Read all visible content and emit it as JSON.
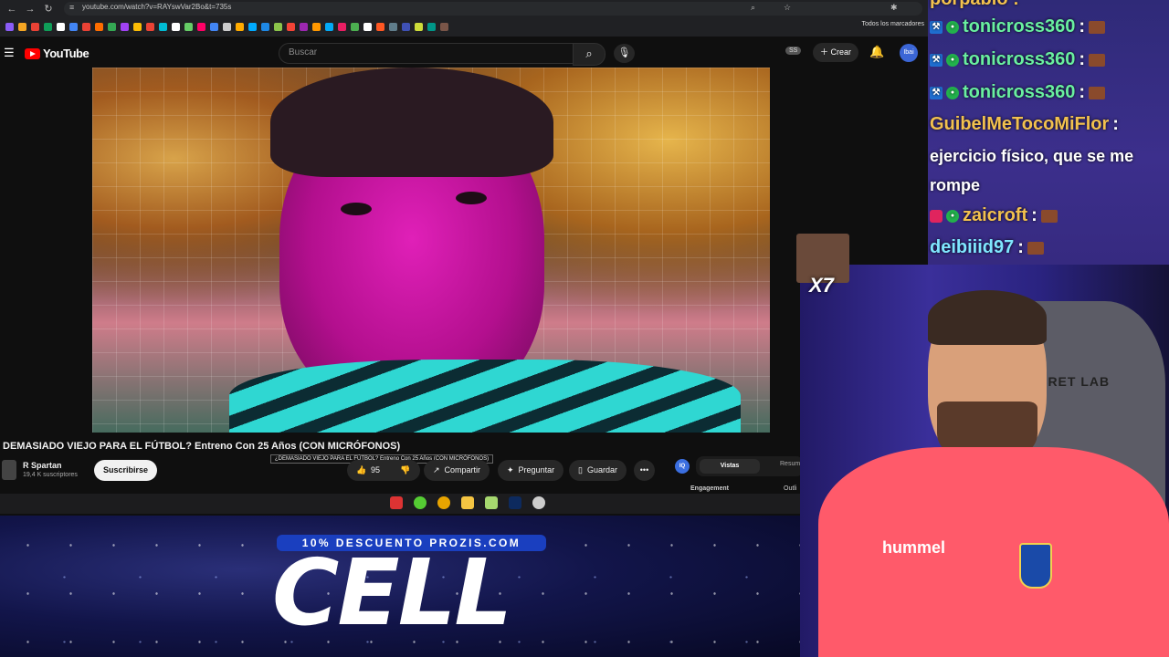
{
  "browser": {
    "url": "youtube.com/watch?v=RAYswVar2Bo&t=735s",
    "bookmarks_folder": "Todos los marcadores"
  },
  "youtube": {
    "logo_text": "YouTube",
    "search_placeholder": "Buscar",
    "ss_badge": "SS",
    "create_label": "Crear",
    "avatar_text": "Ibai"
  },
  "video": {
    "title": "DEMASIADO VIEJO PARA EL FÚTBOL? Entreno Con 25 Años (CON MICRÓFONOS)",
    "tooltip": "¿DEMASIADO VIEJO PARA EL FÚTBOL? Entreno Con 25 Años (CON MICRÓFONOS)",
    "channel": "R Spartan",
    "subscribers": "19,4 K suscriptores",
    "subscribe_label": "Suscribirse",
    "likes": "95",
    "share_label": "Compartir",
    "ask_label": "Preguntar",
    "save_label": "Guardar",
    "more_label": "•••"
  },
  "side_panel": {
    "iq_label": "IQ",
    "tab_active": "Vistas",
    "tab_other": "Resum",
    "engagement": "Engagement",
    "outline": "Outli"
  },
  "sponsor": {
    "promo": "10% DESCUENTO PROZIS.COM",
    "brand": "CELL"
  },
  "chat": {
    "top_partial": "porpabio :",
    "messages": [
      {
        "user": "tonicross360",
        "sep": ":"
      },
      {
        "user": "tonicross360",
        "sep": ":"
      },
      {
        "user": "tonicross360",
        "sep": ":"
      }
    ],
    "guibel_user": "GuibelMeTocoMiFlor",
    "guibel_sep": ":",
    "guibel_text": "ejercicio físico, que se me rompe",
    "zaicroft_user": "zaicroft",
    "zaicroft_sep": ":",
    "deibiiid_user": "deibiiid97",
    "deibiiid_sep": ":"
  },
  "overlay": {
    "multiplier": "X7"
  },
  "webcam": {
    "chair_logo": "ECRET LAB",
    "jersey_brand": "hummel"
  },
  "colors": {
    "yt_red": "#ff0000",
    "chat_bg": "#2f2a78",
    "promo_blue": "#1a3fbf",
    "jersey": "#ff5a6a"
  }
}
